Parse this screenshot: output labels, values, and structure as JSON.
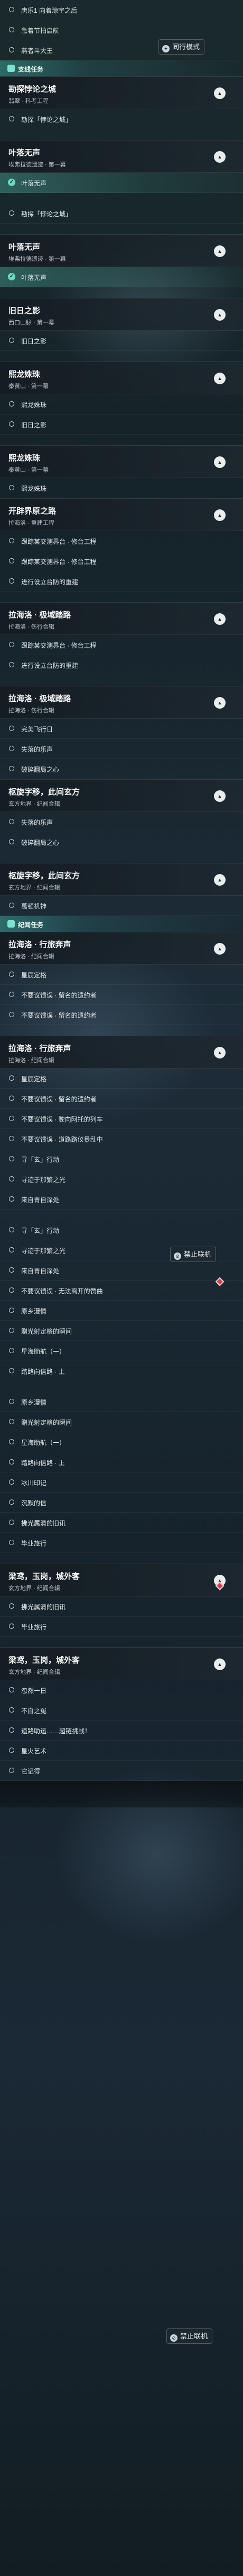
{
  "overlays": {
    "top_badge": {
      "label": "同行模式",
      "icon": "co-op-icon"
    },
    "coop_block_label": "禁止联机"
  },
  "rows": [
    {
      "type": "item",
      "text": "唐乐1 向着琼宇之后"
    },
    {
      "type": "item",
      "text": "急着节拍启航"
    },
    {
      "type": "item",
      "text": "燕者斗大王"
    },
    {
      "type": "category",
      "text": "支线任务"
    },
    {
      "type": "header",
      "title": "勘探悖论之城",
      "subtitle": "翡翠 · 科考工程"
    },
    {
      "type": "item",
      "text": "勘探「悖论之城」"
    },
    {
      "type": "gap"
    },
    {
      "type": "header",
      "title": "叶落无声",
      "subtitle": "埃弗拉德遗迹 · 第一幕"
    },
    {
      "type": "item",
      "text": "叶落无声",
      "selected": true
    },
    {
      "type": "gap"
    },
    {
      "type": "item",
      "text": "勘探「悖论之城」"
    },
    {
      "type": "gap"
    },
    {
      "type": "header",
      "title": "叶落无声",
      "subtitle": "埃弗拉德遗迹 · 第一幕"
    },
    {
      "type": "item",
      "text": "叶落无声",
      "selected": true
    },
    {
      "type": "gap"
    },
    {
      "type": "header",
      "title": "旧日之影",
      "subtitle": "西口山脉 · 第一幕"
    },
    {
      "type": "item",
      "text": "旧日之影"
    },
    {
      "type": "gap"
    },
    {
      "type": "header",
      "title": "熙龙姝珠",
      "subtitle": "秦黄山 · 第一幕"
    },
    {
      "type": "item",
      "text": "熙龙姝珠"
    },
    {
      "type": "item",
      "text": "旧日之影"
    },
    {
      "type": "gap"
    },
    {
      "type": "header",
      "title": "熙龙姝珠",
      "subtitle": "秦黄山 · 第一幕"
    },
    {
      "type": "item",
      "text": "熙龙姝珠"
    },
    {
      "type": "header",
      "title": "开辟界原之路",
      "subtitle": "拉海洛 · 重建工程"
    },
    {
      "type": "item",
      "text": "跟踪某交测界台 · 修台工程"
    },
    {
      "type": "item",
      "text": "跟踪某交测界台 · 修台工程"
    },
    {
      "type": "item",
      "text": "进行设立台防的重建"
    },
    {
      "type": "gap"
    },
    {
      "type": "header",
      "title": "拉海洛 · 极域踏路",
      "subtitle": "拉海洛 · 伤行合辑"
    },
    {
      "type": "item",
      "text": "跟踪某交测界台 · 修台工程"
    },
    {
      "type": "item",
      "text": "进行设立台防的重建"
    },
    {
      "type": "gap"
    },
    {
      "type": "header",
      "title": "拉海洛 · 极域踏路",
      "subtitle": "拉海洛 · 伤行合辑"
    },
    {
      "type": "item",
      "text": "完美飞行日"
    },
    {
      "type": "item",
      "text": "失落的乐声"
    },
    {
      "type": "item",
      "text": "破碎翻局之心"
    },
    {
      "type": "header",
      "title": "枢旋字移，此间玄方",
      "subtitle": "玄方地界 · 纪闻合辑"
    },
    {
      "type": "item",
      "text": "失落的乐声"
    },
    {
      "type": "item",
      "text": "破碎翻局之心"
    },
    {
      "type": "gap"
    },
    {
      "type": "header",
      "title": "枢旋字移，此间玄方",
      "subtitle": "玄方地界 · 纪闻合辑"
    },
    {
      "type": "item",
      "text": "萬顿机神"
    },
    {
      "type": "category",
      "text": "纪闻任务"
    },
    {
      "type": "header",
      "title": "拉海洛 · 行旅奔声",
      "subtitle": "拉海洛 · 纪闻合辑"
    },
    {
      "type": "item",
      "text": "星辰定格"
    },
    {
      "type": "item",
      "text": "不要议馈误 · 留名的遗约者"
    },
    {
      "type": "item",
      "text": "不要议馈误 · 留名的遗约者"
    },
    {
      "type": "gap"
    },
    {
      "type": "header",
      "title": "拉海洛 · 行旅奔声",
      "subtitle": "拉海洛 · 纪闻合辑"
    },
    {
      "type": "item",
      "text": "星辰定格"
    },
    {
      "type": "item",
      "text": "不要议馈误 · 留名的遗约者"
    },
    {
      "type": "item",
      "text": "不要议馈误 · 驶向阿托的列车"
    },
    {
      "type": "item",
      "text": "不要议馈误 · 道路路仪暴乱中"
    },
    {
      "type": "item",
      "text": "寻「玄」行动"
    },
    {
      "type": "item",
      "text": "寻迹于那繁之光"
    },
    {
      "type": "item",
      "text": "来自青自深处"
    },
    {
      "type": "gap"
    },
    {
      "type": "item",
      "text": "寻「玄」行动"
    },
    {
      "type": "item",
      "text": "寻迹于那繁之光"
    },
    {
      "type": "item",
      "text": "来自青自深处"
    },
    {
      "type": "item",
      "text": "不要议馈误 · 无法离开的赞曲"
    },
    {
      "type": "item",
      "text": "原乡漫情"
    },
    {
      "type": "item",
      "text": "赠光射定格的瞬间"
    },
    {
      "type": "item",
      "text": "星海助航（一）"
    },
    {
      "type": "item",
      "text": "踏路向信路 · 上"
    },
    {
      "type": "gap"
    },
    {
      "type": "item",
      "text": "原乡漫情"
    },
    {
      "type": "item",
      "text": "赠光射定格的瞬间"
    },
    {
      "type": "item",
      "text": "星海助航（一）"
    },
    {
      "type": "item",
      "text": "踏路向信路 · 上"
    },
    {
      "type": "item",
      "text": "冰川印记"
    },
    {
      "type": "item",
      "text": "沉默的信"
    },
    {
      "type": "item",
      "text": "拂光属清的旧讯"
    },
    {
      "type": "item",
      "text": "毕业旅行"
    },
    {
      "type": "gap"
    },
    {
      "type": "header",
      "title": "梁鸢，玉岗，城外客",
      "subtitle": "玄方地界 · 纪闻合辑"
    },
    {
      "type": "item",
      "text": "拂光属清的旧讯"
    },
    {
      "type": "item",
      "text": "毕业旅行"
    },
    {
      "type": "gap"
    },
    {
      "type": "header",
      "title": "梁鸢，玉岗，城外客",
      "subtitle": "玄方地界 · 纪闻合辑"
    },
    {
      "type": "item",
      "text": "忽然一日"
    },
    {
      "type": "item",
      "text": "不白之冤"
    },
    {
      "type": "item",
      "text": "道路助运……超链挑战！"
    },
    {
      "type": "item",
      "text": "星火艺术"
    },
    {
      "type": "item",
      "text": "它记得"
    },
    {
      "type": "grad"
    }
  ]
}
